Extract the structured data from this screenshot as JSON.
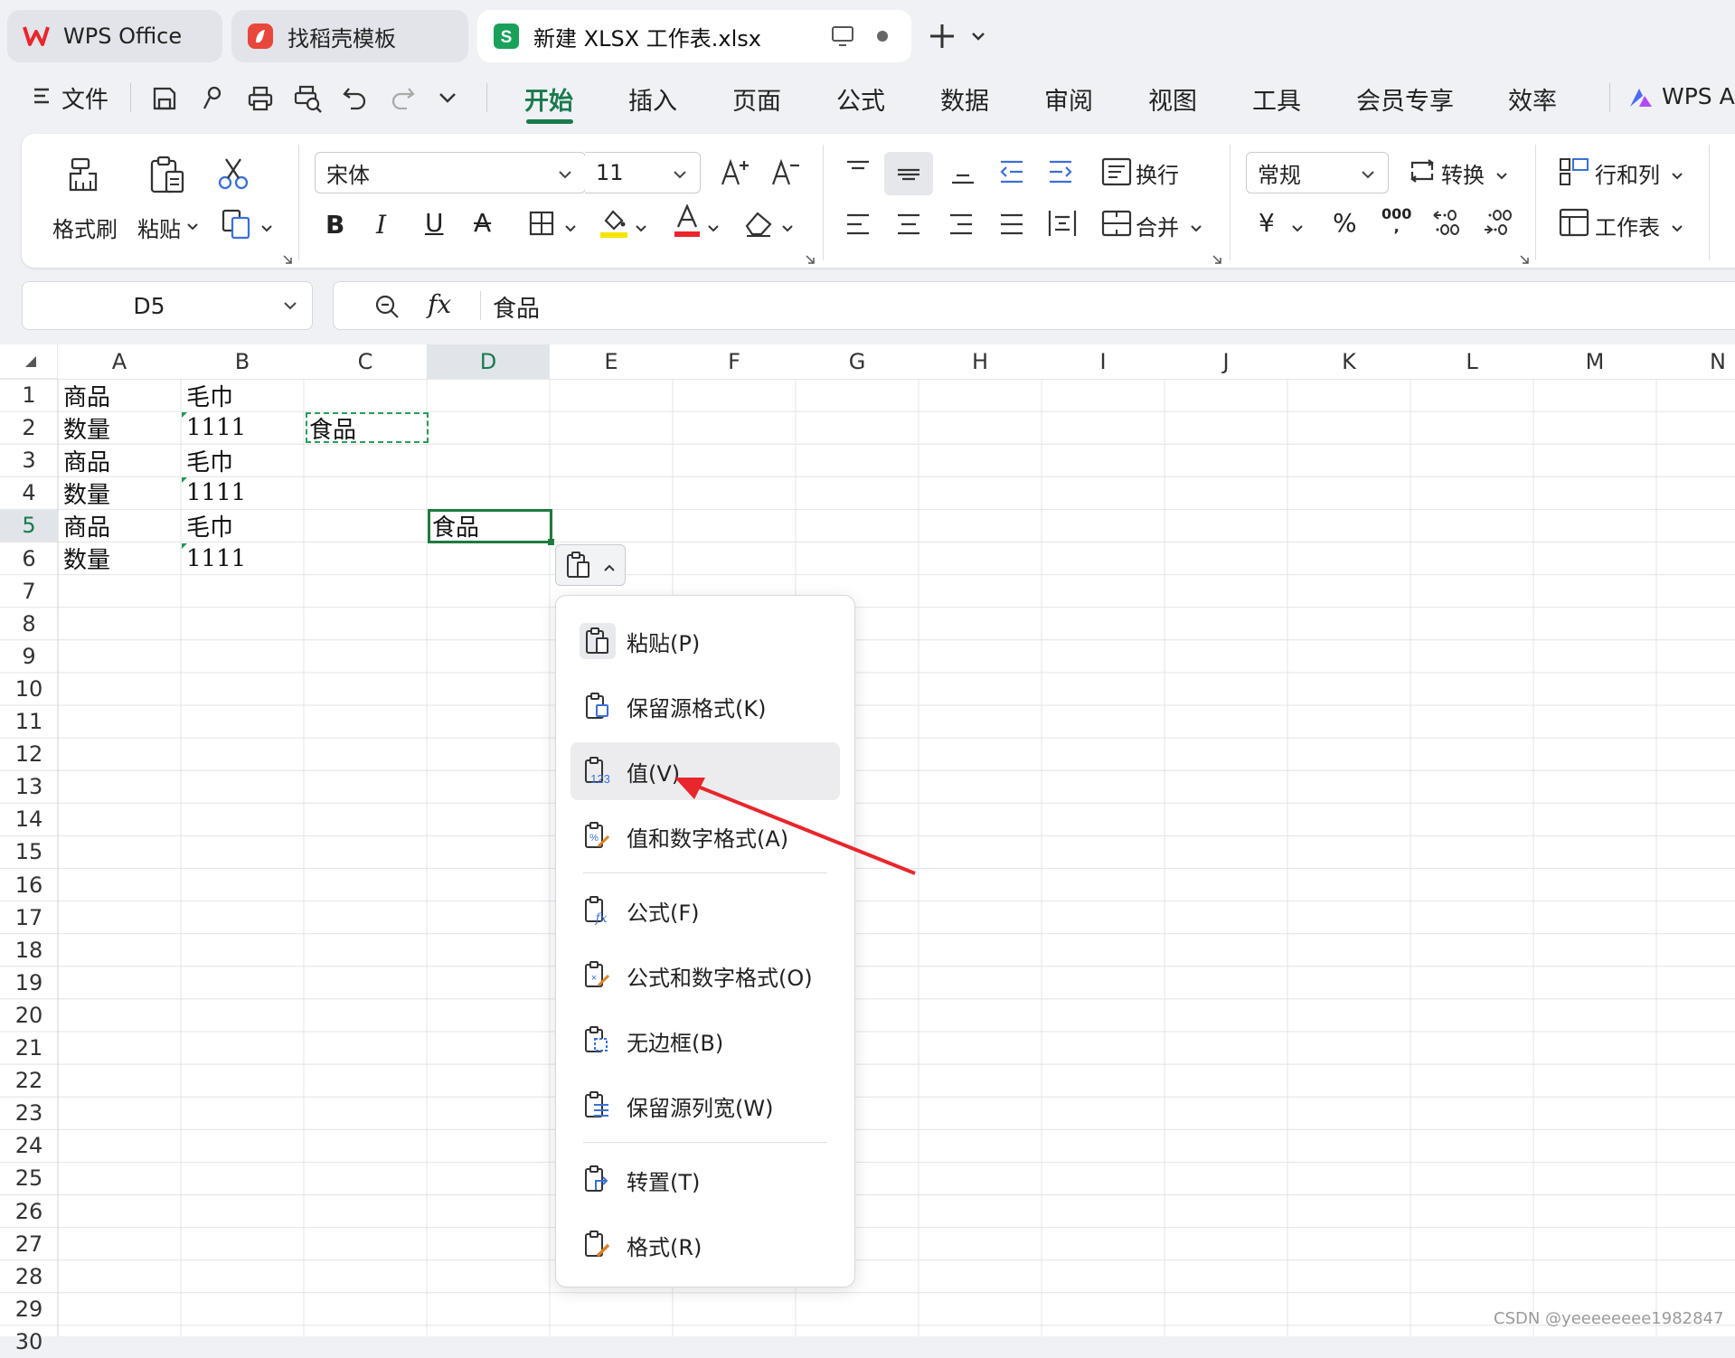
{
  "tabs": [
    {
      "label": "WPS Office"
    },
    {
      "label": "找稻壳模板"
    },
    {
      "label": "新建 XLSX 工作表.xlsx"
    }
  ],
  "quick_access": {
    "file_label": "文件"
  },
  "menu_tabs": [
    "开始",
    "插入",
    "页面",
    "公式",
    "数据",
    "审阅",
    "视图",
    "工具",
    "会员专享",
    "效率"
  ],
  "ai_label": "WPS A",
  "ribbon": {
    "format_painter": "格式刷",
    "paste": "粘贴",
    "font_name": "宋体",
    "font_size": "11",
    "wrap": "换行",
    "merge": "合并",
    "number_format": "常规",
    "convert": "转换",
    "rows_cols": "行和列",
    "worksheet": "工作表",
    "currency_symbol": "¥",
    "percent_symbol": "%",
    "thousands_symbol": "000"
  },
  "formula_bar": {
    "cell_ref": "D5",
    "fx": "fx",
    "content": "食品"
  },
  "sheet": {
    "columns": [
      "A",
      "B",
      "C",
      "D",
      "E",
      "F",
      "G",
      "H",
      "I",
      "J",
      "K",
      "L",
      "M",
      "N"
    ],
    "selected_column": "D",
    "rows": [
      "1",
      "2",
      "3",
      "4",
      "5",
      "6",
      "7",
      "8",
      "9",
      "10",
      "11",
      "12",
      "13",
      "14",
      "15",
      "16",
      "17",
      "18",
      "19",
      "20",
      "21",
      "22",
      "23",
      "24",
      "25",
      "26",
      "27",
      "28",
      "29",
      "30"
    ],
    "selected_row": "5",
    "cells": {
      "A1": "商品",
      "B1": "毛巾",
      "A2": "数量",
      "B2": "1111",
      "C2": "食品",
      "A3": "商品",
      "B3": "毛巾",
      "A4": "数量",
      "B4": "1111",
      "A5": "商品",
      "B5": "毛巾",
      "D5": "食品",
      "A6": "数量",
      "B6": "1111"
    }
  },
  "paste_menu": {
    "items": [
      {
        "label": "粘贴(P)",
        "icon": "paste-icon"
      },
      {
        "label": "保留源格式(K)",
        "icon": "keep-source-format-icon"
      },
      {
        "label": "值(V)",
        "icon": "paste-values-icon"
      },
      {
        "label": "值和数字格式(A)",
        "icon": "values-number-format-icon"
      },
      {
        "label": "公式(F)",
        "icon": "paste-formula-icon"
      },
      {
        "label": "公式和数字格式(O)",
        "icon": "formula-number-format-icon"
      },
      {
        "label": "无边框(B)",
        "icon": "no-border-icon"
      },
      {
        "label": "保留源列宽(W)",
        "icon": "keep-column-width-icon"
      },
      {
        "label": "转置(T)",
        "icon": "transpose-icon"
      },
      {
        "label": "格式(R)",
        "icon": "paste-format-icon"
      }
    ],
    "highlighted": "值(V)"
  },
  "colors": {
    "accent_green": "#1a7a4e",
    "annotation_red": "#e8262b"
  },
  "watermark": "CSDN @yeeeeeeee1982847"
}
